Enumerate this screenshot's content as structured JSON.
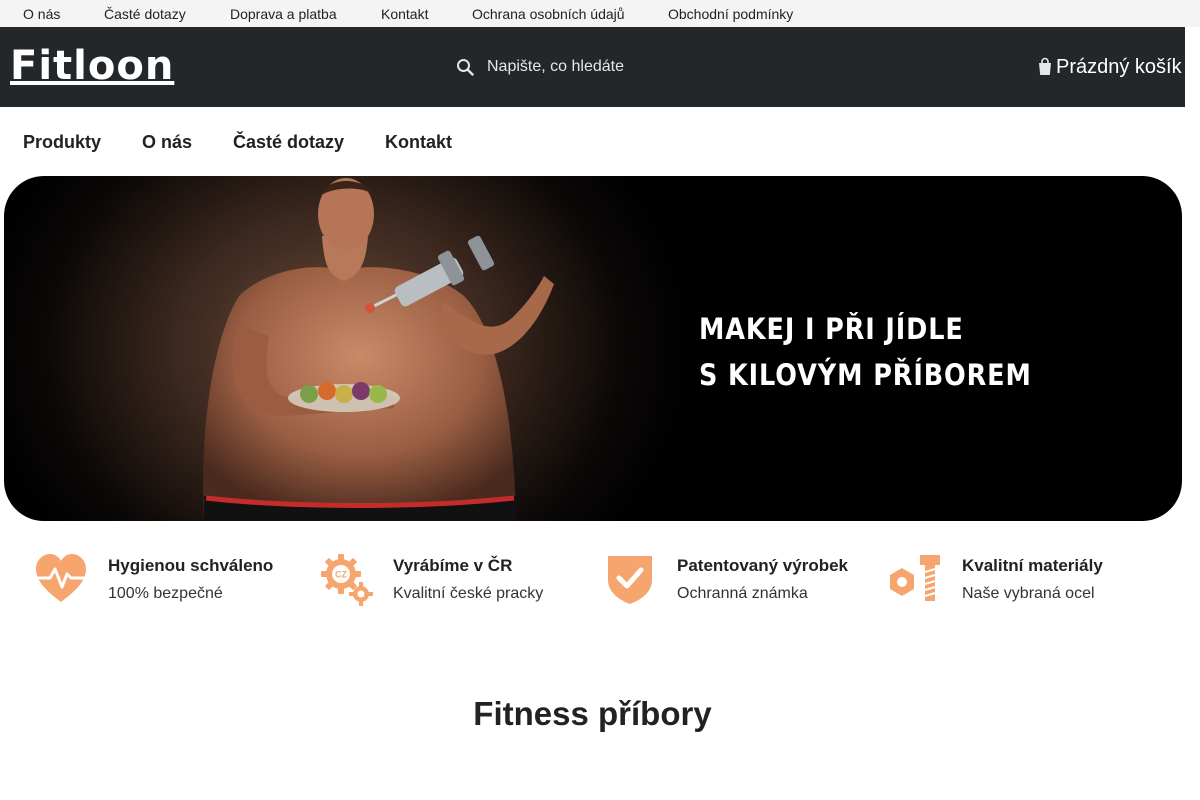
{
  "topbar": {
    "links": [
      "O nás",
      "Časté dotazy",
      "Doprava a platba",
      "Kontakt",
      "Ochrana osobních údajů",
      "Obchodní podmínky"
    ]
  },
  "header": {
    "logo": "Fitloon",
    "search_placeholder": "Napište, co hledáte",
    "cart_label": "Prázdný košík",
    "icons": {
      "search": "search-icon",
      "cart": "cart-icon"
    }
  },
  "nav": {
    "items": [
      "Produkty",
      "O nás",
      "Časté dotazy",
      "Kontakt"
    ]
  },
  "hero": {
    "line1": "MAKEJ I PŘI JÍDLE",
    "line2": "S KILOVÝM PŘÍBOREM"
  },
  "features": [
    {
      "icon": "heart-pulse-icon",
      "title": "Hygienou schváleno",
      "subtitle": "100% bezpečné"
    },
    {
      "icon": "gear-cz-icon",
      "title": "Vyrábíme v ČR",
      "subtitle": "Kvalitní české pracky"
    },
    {
      "icon": "shield-check-icon",
      "title": "Patentovaný výrobek",
      "subtitle": "Ochranná známka"
    },
    {
      "icon": "nut-bolt-icon",
      "title": "Kvalitní materiály",
      "subtitle": "Naše vybraná ocel"
    }
  ],
  "section": {
    "title": "Fitness příbory"
  },
  "colors": {
    "accent": "#f6a56f",
    "header_bg": "#24272a",
    "topbar_bg": "#f4f4f4"
  }
}
